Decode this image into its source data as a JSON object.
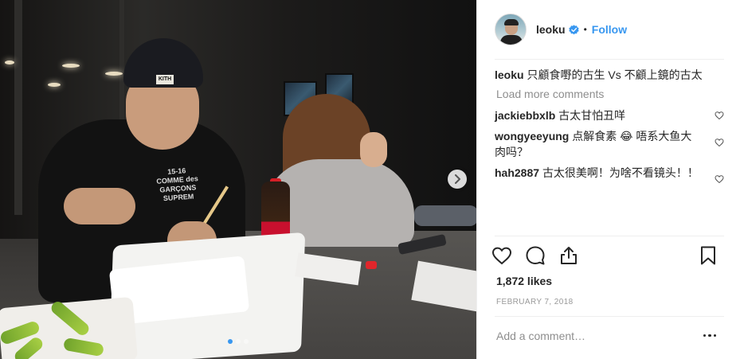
{
  "post": {
    "media": {
      "cap_logo_text": "KITH",
      "shirt_text_line1": "15-16",
      "shirt_text_line2": "COMME des GARÇONS",
      "shirt_text_line3": "SUPREM",
      "carousel_dots": 3,
      "active_dot": 0
    },
    "header": {
      "username": "leoku",
      "separator": "•",
      "follow_label": "Follow",
      "verified": true
    },
    "caption": {
      "username": "leoku",
      "text": "只顧食嘢的古生 Vs 不顧上鏡的古太"
    },
    "load_more_label": "Load more comments",
    "comments": [
      {
        "username": "jackiebbxlb",
        "text": "古太甘怕丑咩"
      },
      {
        "username": "wongyeeyung",
        "text": "点解食素 😂 唔系大鱼大肉吗？"
      },
      {
        "username": "hah2887",
        "text": "古太很美啊！为啥不看镜头！！"
      }
    ],
    "likes_text": "1,872 likes",
    "date": "February 7, 2018",
    "add_comment_placeholder": "Add a comment…",
    "colors": {
      "accent": "#3897f0",
      "text": "#262626",
      "muted": "#8e8e8e",
      "border": "#efefef"
    }
  }
}
